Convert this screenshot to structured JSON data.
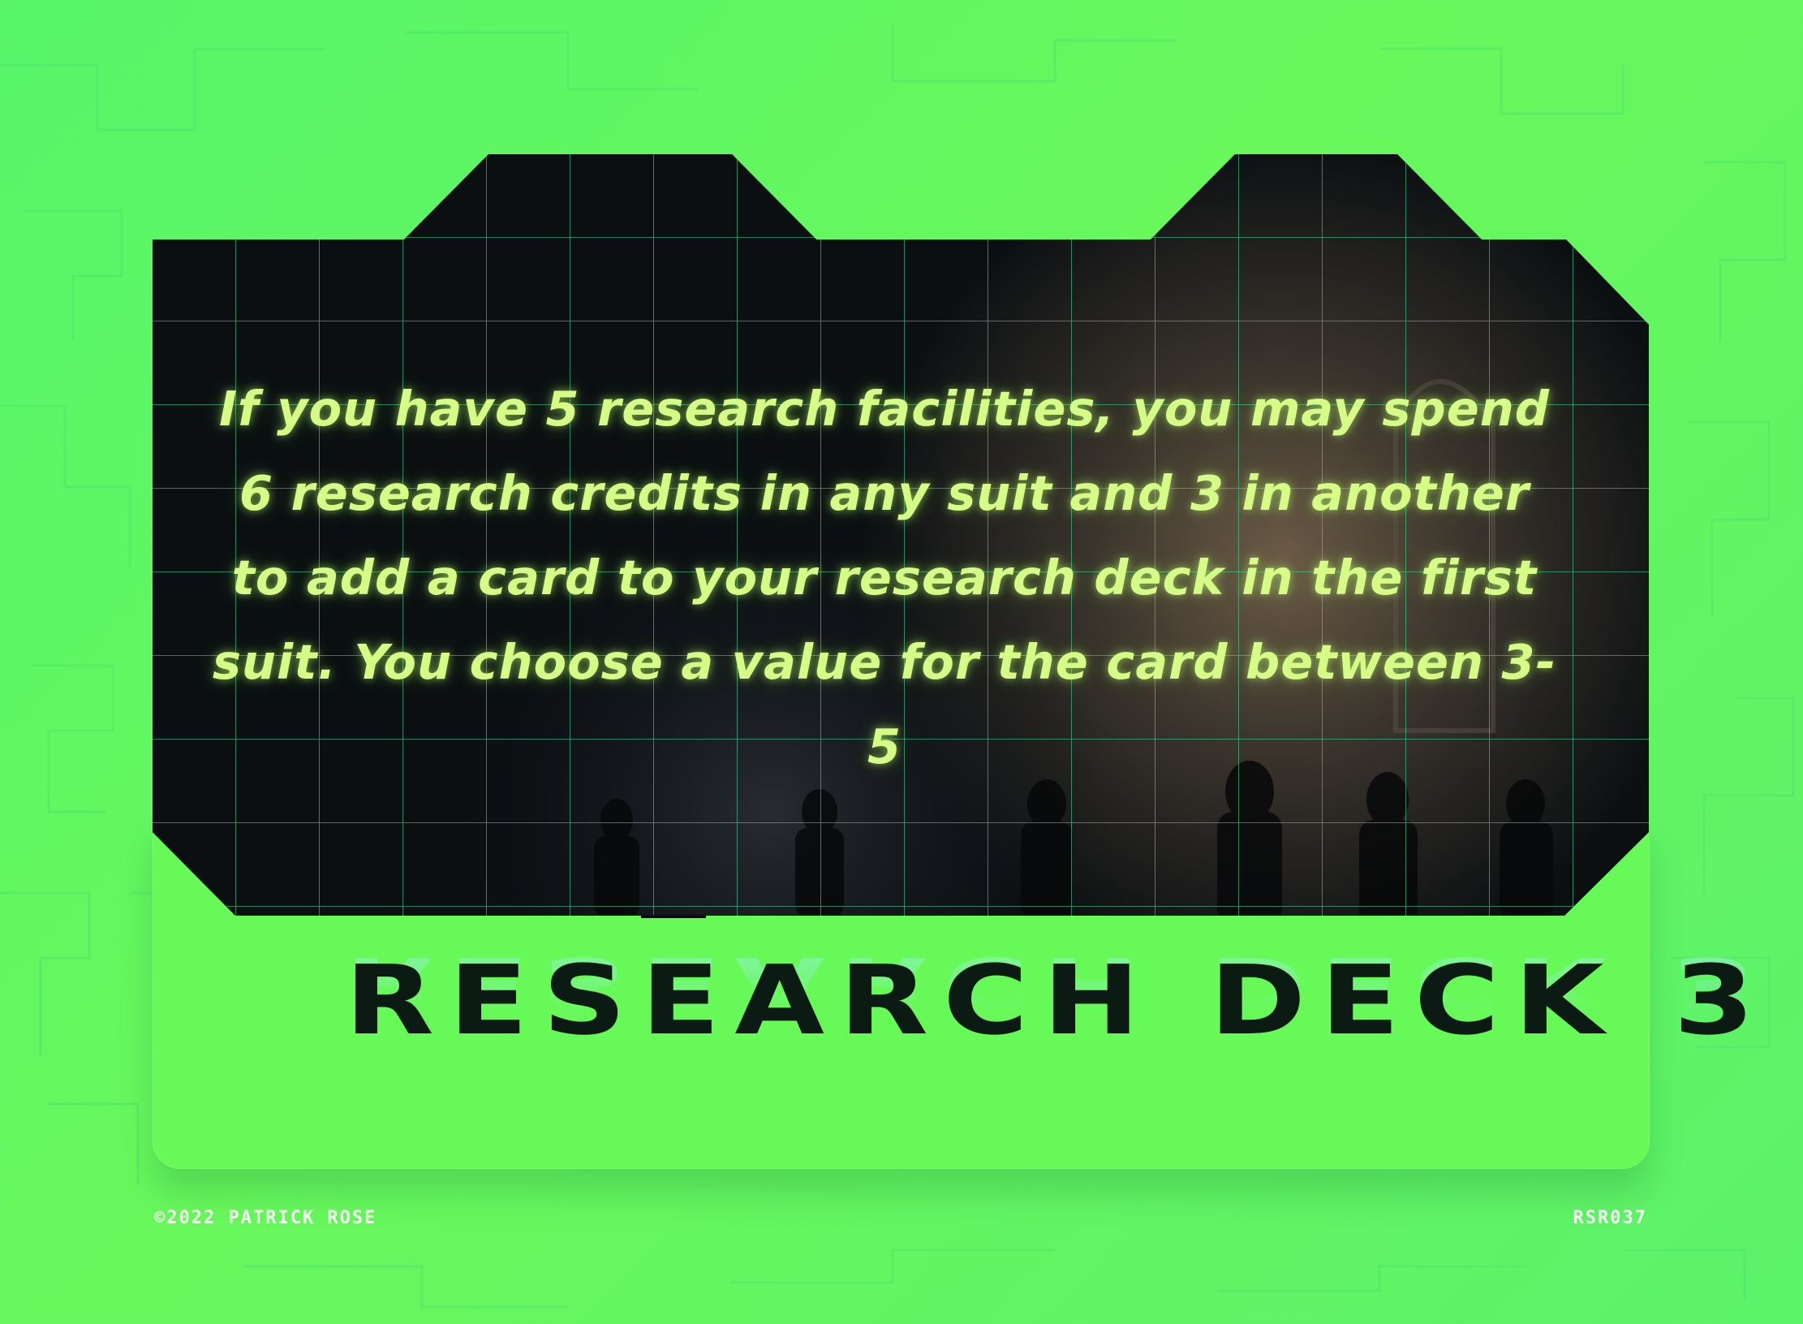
{
  "card": {
    "rule_text": "If you have 5 research facilities, you may spend 6 research credits in any suit and 3 in another to add a card to your research deck in the first suit. You choose a value for the card between 3-5",
    "title": "RESEARCH DECK 3",
    "copyright": "©2022 PATRICK ROSE",
    "code": "RSR037"
  },
  "colors": {
    "background": "#5cf46a",
    "card_green": "#66f957",
    "screen_dark": "#0b0f12",
    "grid_line": "#3bd79a",
    "rule_text": "#d6fb86",
    "title_text": "#0c1a14"
  }
}
